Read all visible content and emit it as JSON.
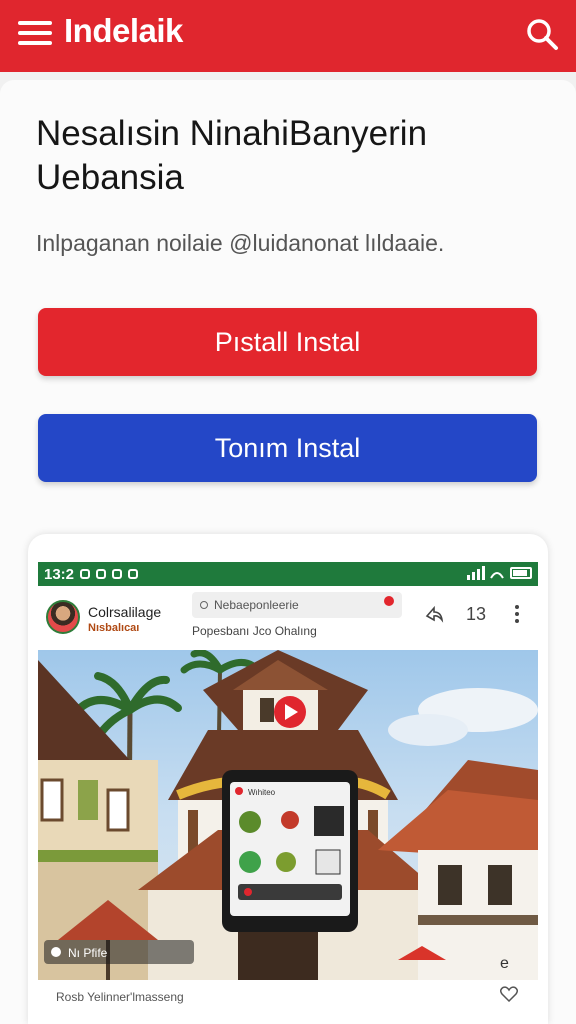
{
  "header": {
    "title": "Indelaik",
    "menu_icon": "hamburger-menu-icon",
    "search_icon": "search-icon",
    "color": "#e0262e"
  },
  "main": {
    "headline": "Nesalısin NinahiBanyerin Uebansia",
    "subline": "Inlpaganan noilaie @luidanonat lıldaaie.",
    "primary_button": "Pıstall Instal",
    "secondary_button": "Tonım Instal",
    "primary_color": "#e3262d",
    "secondary_color": "#2447c7"
  },
  "preview": {
    "status_time": "13:2",
    "channel_name": "Colrsalilage",
    "channel_sub": "Nısbalıcaı",
    "search_placeholder": "Nebaeponleerie",
    "sub_text": "Popesbanı Jco Ohalıng",
    "share_icon": "share-icon",
    "count_label": "13",
    "more_icon": "more-vertical-icon",
    "caption": "Rosb Yelinner'lmasseng",
    "heart_icon": "heart-icon",
    "tablet_label": "Wıhiteo",
    "overlay_label": "Nı Pfife"
  }
}
